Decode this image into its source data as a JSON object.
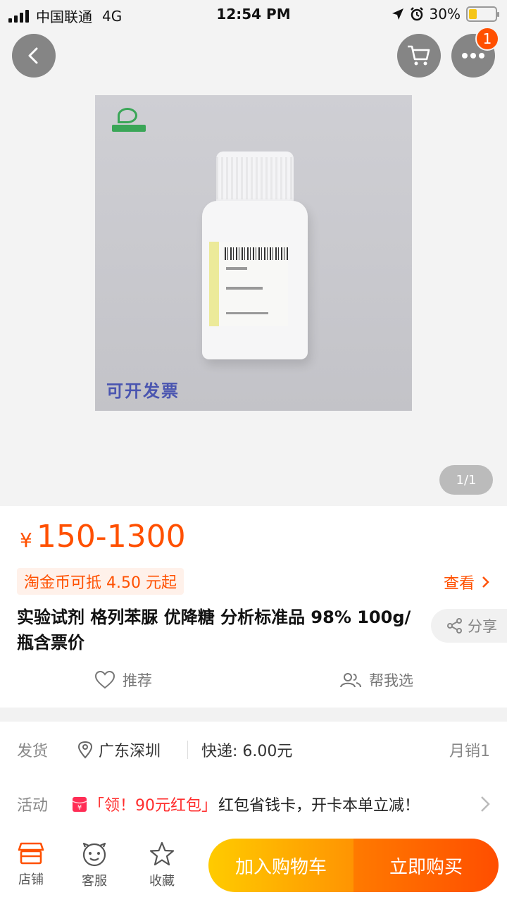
{
  "status_bar": {
    "carrier": "中国联通",
    "network": "4G",
    "time": "12:54 PM",
    "battery_percent": "30%",
    "battery_level": 0.3
  },
  "gallery": {
    "watermark": "可开发票",
    "pager": "1/1"
  },
  "header": {
    "cart_badge": "1"
  },
  "product": {
    "currency": "¥",
    "price": "150-1300",
    "coin_offer": "淘金币可抵 4.50 元起",
    "check_label": "查看",
    "title": "实验试剂 格列苯脲 优降糖 分析标准品 98% 100g/瓶含票价",
    "share_label": "分享",
    "recommend_label": "推荐",
    "help_choose_label": "帮我选"
  },
  "shipping": {
    "key": "发货",
    "location": "广东深圳",
    "fee": "快递: 6.00元",
    "monthly_sales": "月销1"
  },
  "activity": {
    "key": "活动",
    "promo_highlight": "「领！90元红包」",
    "promo_text": "红包省钱卡，开卡本单立减！"
  },
  "bottom_bar": {
    "shop_label": "店铺",
    "service_label": "客服",
    "favorite_label": "收藏",
    "add_cart_label": "加入购物车",
    "buy_now_label": "立即购买"
  },
  "colors": {
    "accent": "#ff5000",
    "cart_button": "#ffb000",
    "buy_button": "#ff5a00"
  }
}
